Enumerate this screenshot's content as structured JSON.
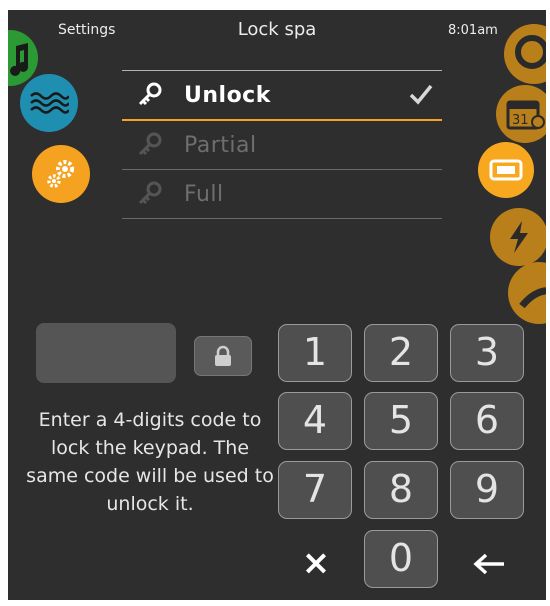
{
  "header": {
    "settings_label": "Settings",
    "title": "Lock spa",
    "time": "8:01am"
  },
  "side_icons": {
    "left": [
      "music-icon",
      "water-icon",
      "gear-icon"
    ],
    "right": [
      "settings-arc-icon",
      "calendar-icon",
      "display-icon",
      "lightning-icon",
      "arc-icon"
    ],
    "calendar_day": "31"
  },
  "lock_options": [
    {
      "label": "Unlock",
      "selected": true
    },
    {
      "label": "Partial",
      "selected": false
    },
    {
      "label": "Full",
      "selected": false
    }
  ],
  "instructions": "Enter a 4-digits code to lock the keypad. The same code will be used to unlock it.",
  "keypad": {
    "keys": [
      "1",
      "2",
      "3",
      "4",
      "5",
      "6",
      "7",
      "8",
      "9",
      "0"
    ],
    "clear": "×",
    "back": "backspace-arrow-icon"
  },
  "colors": {
    "background": "#2e2e2e",
    "accent": "#f4a21f",
    "water": "#1f8fb1",
    "music": "#2b9a35"
  }
}
